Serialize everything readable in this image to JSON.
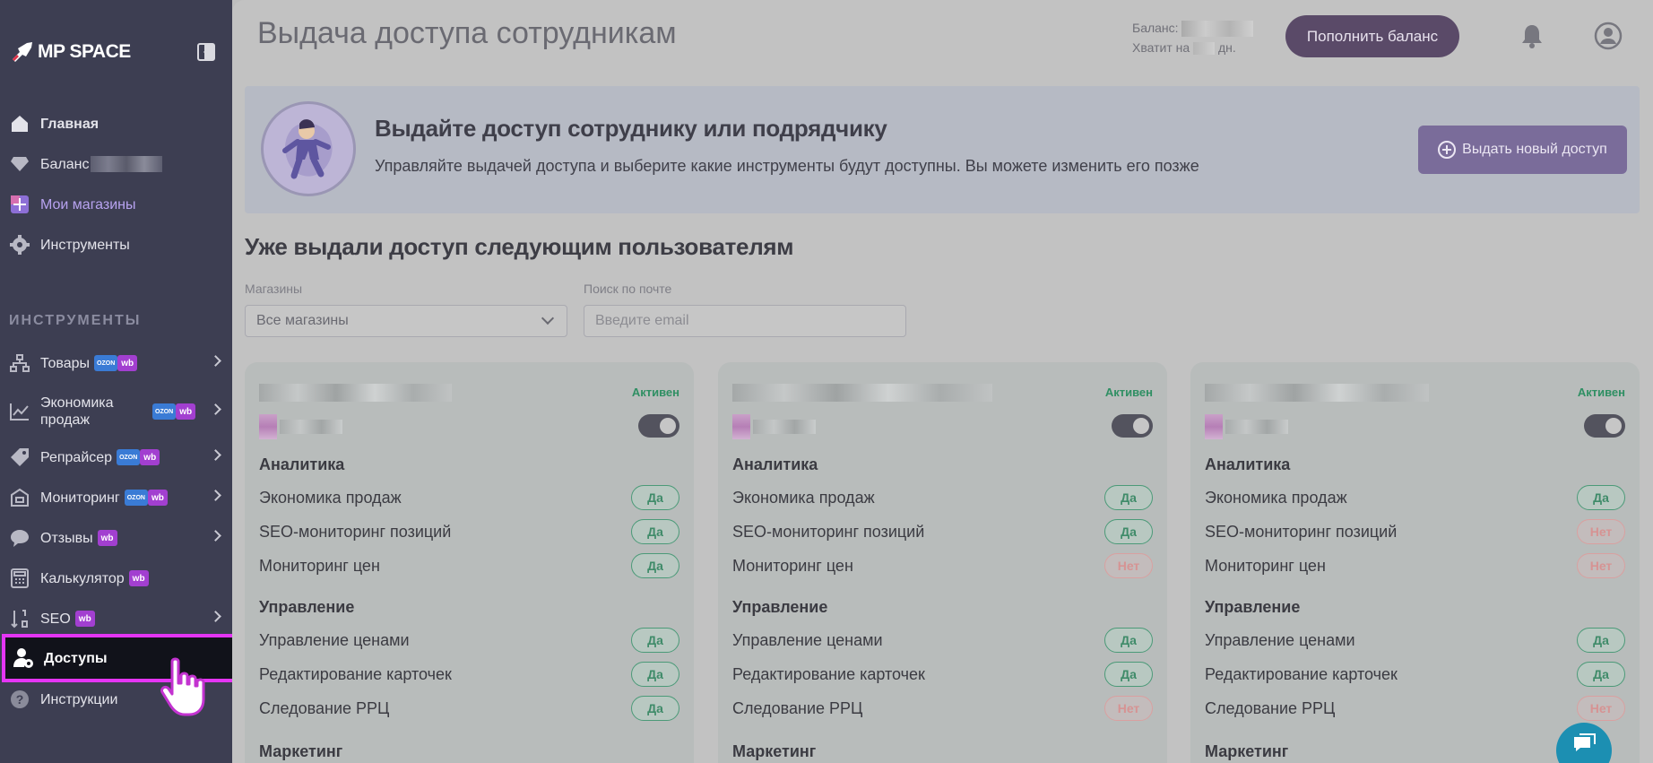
{
  "app": {
    "brand": "MP SPACE"
  },
  "sidebar": {
    "items": [
      {
        "label": "Главная",
        "icon": "home-icon"
      },
      {
        "label": "Баланс",
        "icon": "diamond-icon"
      },
      {
        "label": "Мои магазины",
        "icon": "plus-store-icon"
      },
      {
        "label": "Инструменты",
        "icon": "gear-icon"
      }
    ],
    "section_label": "ИНСТРУМЕНТЫ",
    "tools": [
      {
        "label": "Товары",
        "badges": [
          "OZON",
          "wb"
        ]
      },
      {
        "label": "Экономика продаж",
        "badges": [
          "OZON",
          "wb"
        ]
      },
      {
        "label": "Репрайсер",
        "badges": [
          "OZON",
          "wb"
        ]
      },
      {
        "label": "Мониторинг",
        "badges": [
          "OZON",
          "wb"
        ]
      },
      {
        "label": "Отзывы",
        "badges": [
          "wb"
        ]
      },
      {
        "label": "Калькулятор",
        "badges": [
          "wb"
        ]
      },
      {
        "label": "SEO",
        "badges": [
          "wb"
        ]
      },
      {
        "label": "Доступы",
        "badges": []
      },
      {
        "label": "Инструкции",
        "badges": []
      }
    ]
  },
  "header": {
    "title": "Выдача доступа сотрудникам",
    "balance_label": "Баланс:",
    "enough_label": "Хватит на",
    "days_suffix": "дн.",
    "topup_label": "Пополнить баланс"
  },
  "banner": {
    "title": "Выдайте доступ сотруднику или подрядчику",
    "text": "Управляйте выдачей доступа и выберите какие инструменты будут доступны. Вы можете изменить его позже",
    "button_label": "Выдать новый доступ"
  },
  "list": {
    "title": "Уже выдали доступ следующим пользователям",
    "stores_label": "Магазины",
    "stores_value": "Все магазины",
    "email_label": "Поиск по почте",
    "email_placeholder": "Введите email"
  },
  "card_labels": {
    "status": "Активен",
    "group_analytics": "Аналитика",
    "group_management": "Управление",
    "group_marketing": "Маркетинг",
    "perm_1": "Экономика продаж",
    "perm_2": "SEO-мониторинг позиций",
    "perm_3": "Мониторинг цен",
    "perm_4": "Управление ценами",
    "perm_5": "Редактирование карточек",
    "perm_6": "Следование РРЦ"
  },
  "cards": [
    {
      "perms": [
        "Да",
        "Да",
        "Да",
        "Да",
        "Да",
        "Да"
      ]
    },
    {
      "perms": [
        "Да",
        "Да",
        "Нет",
        "Да",
        "Да",
        "Нет"
      ]
    },
    {
      "perms": [
        "Да",
        "Нет",
        "Нет",
        "Да",
        "Да",
        "Нет"
      ]
    }
  ],
  "colors": {
    "sidebar_bg": "#3d3e52",
    "active_highlight": "#e535f5",
    "accent_button": "#7a6c9a",
    "yes_green": "#3f8b69",
    "no_red": "#d69393"
  }
}
